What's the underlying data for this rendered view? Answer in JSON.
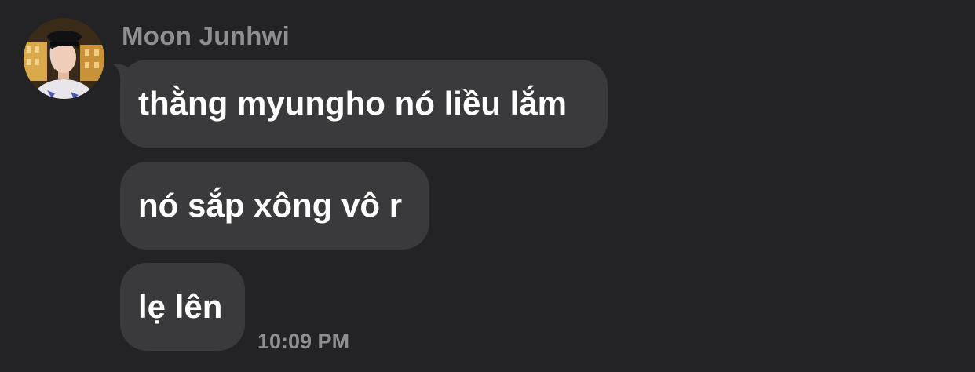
{
  "sender": {
    "name": "Moon Junhwi",
    "avatar_icon": "profile-photo"
  },
  "messages": [
    {
      "text": "thằng myungho nó liều lắm"
    },
    {
      "text": "nó sắp xông vô r"
    },
    {
      "text": "lẹ lên"
    }
  ],
  "timestamp": "10:09 PM",
  "colors": {
    "background": "#232325",
    "bubble": "#3a3a3c",
    "message_text": "#ffffff",
    "secondary_text": "#8e8e93"
  }
}
